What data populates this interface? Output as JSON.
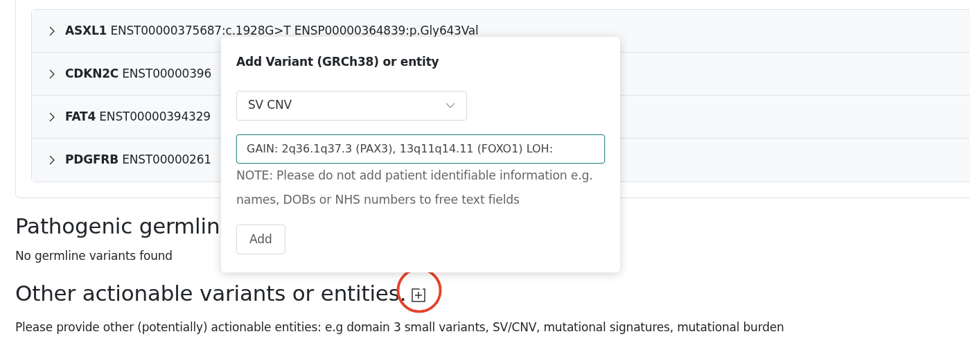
{
  "variant_list": [
    {
      "gene": "ASXL1",
      "detail": "ENST00000375687:c.1928G>T ENSP00000364839:p.Gly643Val",
      "expanded": false
    },
    {
      "gene": "CDKN2C",
      "detail": "ENST00000396",
      "expanded": false
    },
    {
      "gene": "FAT4",
      "detail": "ENST00000394329",
      "expanded": false
    },
    {
      "gene": "PDGFRB",
      "detail": "ENST00000261",
      "expanded": false
    }
  ],
  "popover": {
    "title": "Add Variant (GRCh38) or entity",
    "select": {
      "value": "SV CNV"
    },
    "text_input": {
      "value": "GAIN: 2q36.1q37.3 (PAX3), 13q11q14.11 (FOXO1) LOH:"
    },
    "note": "NOTE: Please do not add patient identifiable information e.g. names, DOBs or NHS numbers to free text fields",
    "add_button": "Add"
  },
  "germline": {
    "heading": "Pathogenic germlin",
    "message": "No germline variants found"
  },
  "other": {
    "heading": "Other actionable variants or entities.",
    "highlighted": true,
    "description": "Please provide other (potentially) actionable entities: e.g domain 3 small variants, SV/CNV, mutational signatures, mutational burden"
  }
}
